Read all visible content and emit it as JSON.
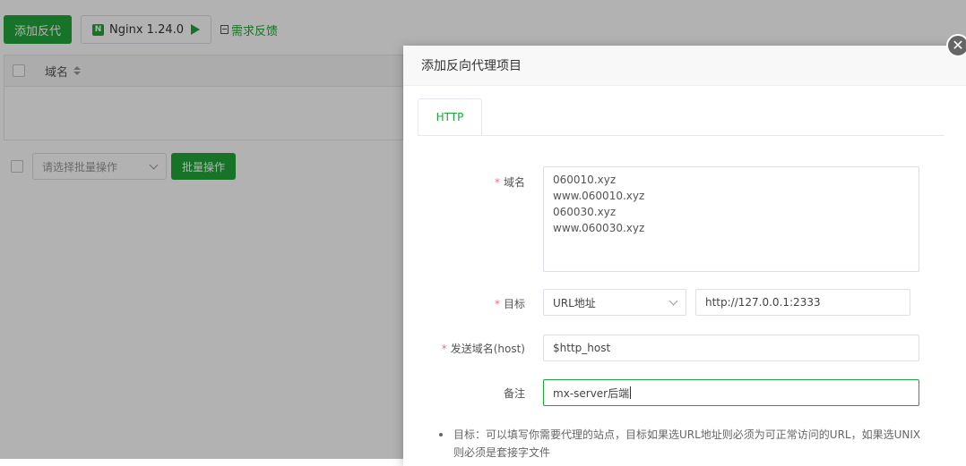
{
  "toolbar": {
    "add_proxy_label": "添加反代",
    "nginx_label": "Nginx 1.24.0",
    "nginx_icon_letter": "N",
    "feedback_label": "需求反馈"
  },
  "table": {
    "col_domain": "域名"
  },
  "batch": {
    "select_placeholder": "请选择批量操作",
    "button_label": "批量操作"
  },
  "dialog": {
    "title": "添加反向代理项目",
    "close_symbol": "✕",
    "tabs": [
      {
        "label": "HTTP"
      }
    ],
    "fields": {
      "domain": {
        "label": "域名",
        "required": true,
        "lines": [
          "060010.xyz",
          "www.060010.xyz",
          "060030.xyz",
          "www.060030.xyz"
        ]
      },
      "target": {
        "label": "目标",
        "required": true,
        "type_value": "URL地址",
        "url_value": "http://127.0.0.1:2333"
      },
      "send_host": {
        "label": "发送域名(host)",
        "required": true,
        "value": "$http_host"
      },
      "remark": {
        "label": "备注",
        "required": false,
        "value": "mx-server后端"
      }
    },
    "hint": "目标：可以填写你需要代理的站点，目标如果选URL地址则必须为可正常访问的URL，如果选UNIX则必须是套接字文件"
  },
  "colors": {
    "accent": "#20a53a",
    "required": "#f56c6c",
    "mask": "rgba(0,0,0,0.3)"
  }
}
